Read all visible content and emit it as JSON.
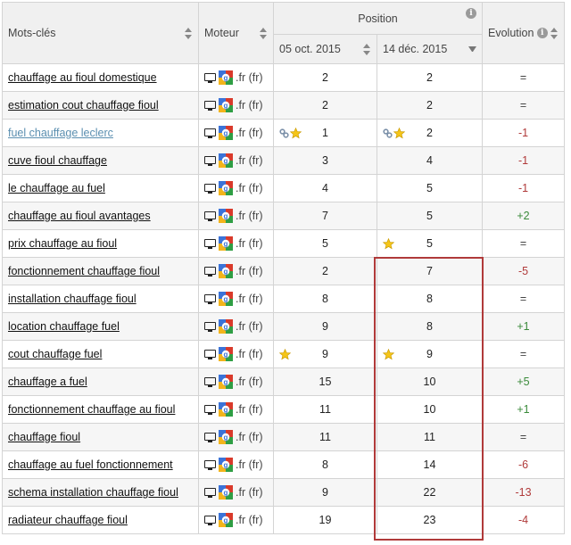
{
  "header": {
    "keywords_label": "Mots-clés",
    "engine_label": "Moteur",
    "position_label": "Position",
    "date1_label": "05 oct. 2015",
    "date2_label": "14 déc. 2015",
    "evolution_label": "Evolution"
  },
  "engine_suffix": ".fr (fr)",
  "colors": {
    "negative": "#b03a3a",
    "positive": "#3a8a3a",
    "highlight": "#b03a3a"
  },
  "rows": [
    {
      "keyword": "chauffage au fioul domestique",
      "pos1": "2",
      "pos2": "2",
      "evolution": "="
    },
    {
      "keyword": "estimation cout chauffage fioul",
      "pos1": "2",
      "pos2": "2",
      "evolution": "="
    },
    {
      "keyword": "fuel chauffage leclerc",
      "pos1": "1",
      "pos2": "2",
      "evolution": "-1",
      "visited": true,
      "icons1": [
        "link-icon",
        "star-icon"
      ],
      "icons2": [
        "link-icon",
        "star-icon"
      ]
    },
    {
      "keyword": "cuve fioul chauffage",
      "pos1": "3",
      "pos2": "4",
      "evolution": "-1"
    },
    {
      "keyword": "le chauffage au fuel",
      "pos1": "4",
      "pos2": "5",
      "evolution": "-1"
    },
    {
      "keyword": "chauffage au fioul avantages",
      "pos1": "7",
      "pos2": "5",
      "evolution": "+2"
    },
    {
      "keyword": "prix chauffage au fioul",
      "pos1": "5",
      "pos2": "5",
      "evolution": "=",
      "icons2": [
        "star-icon"
      ]
    },
    {
      "keyword": "fonctionnement chauffage fioul",
      "pos1": "2",
      "pos2": "7",
      "evolution": "-5"
    },
    {
      "keyword": "installation chauffage fioul",
      "pos1": "8",
      "pos2": "8",
      "evolution": "="
    },
    {
      "keyword": "location chauffage fuel",
      "pos1": "9",
      "pos2": "8",
      "evolution": "+1"
    },
    {
      "keyword": "cout chauffage fuel",
      "pos1": "9",
      "pos2": "9",
      "evolution": "=",
      "icons1": [
        "star-icon"
      ],
      "icons2": [
        "star-icon"
      ]
    },
    {
      "keyword": "chauffage a fuel",
      "pos1": "15",
      "pos2": "10",
      "evolution": "+5"
    },
    {
      "keyword": "fonctionnement chauffage au fioul",
      "pos1": "11",
      "pos2": "10",
      "evolution": "+1"
    },
    {
      "keyword": "chauffage fioul",
      "pos1": "11",
      "pos2": "11",
      "evolution": "="
    },
    {
      "keyword": "chauffage au fuel fonctionnement",
      "pos1": "8",
      "pos2": "14",
      "evolution": "-6"
    },
    {
      "keyword": "schema installation chauffage fioul",
      "pos1": "9",
      "pos2": "22",
      "evolution": "-13"
    },
    {
      "keyword": "radiateur chauffage fioul",
      "pos1": "19",
      "pos2": "23",
      "evolution": "-4"
    }
  ]
}
